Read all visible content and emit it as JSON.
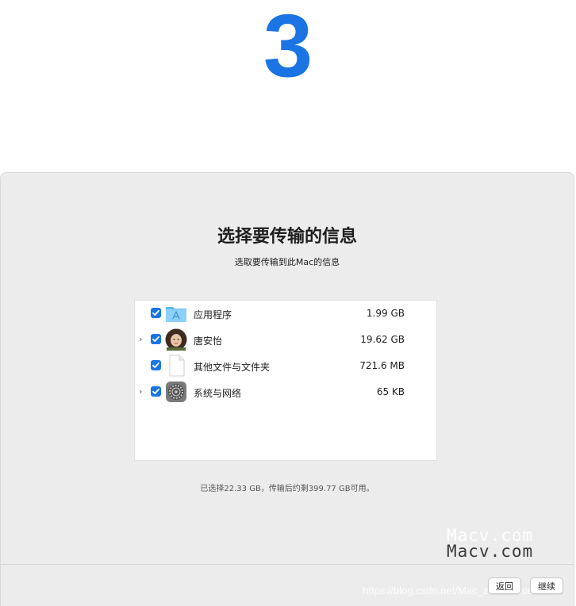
{
  "step_number": "3",
  "dialog": {
    "title": "选择要传输的信息",
    "subtitle": "选取要传输到此Mac的信息",
    "items": [
      {
        "label": "应用程序",
        "size": "1.99 GB",
        "checked": true,
        "expandable": false,
        "icon": "applications-folder-icon"
      },
      {
        "label": "唐安怡",
        "size": "19.62 GB",
        "checked": true,
        "expandable": true,
        "icon": "user-avatar-icon"
      },
      {
        "label": "其他文件与文件夹",
        "size": "721.6 MB",
        "checked": true,
        "expandable": false,
        "icon": "document-icon"
      },
      {
        "label": "系统与网络",
        "size": "65 KB",
        "checked": true,
        "expandable": true,
        "icon": "system-preferences-gear-icon"
      }
    ],
    "status": "已选择22.33 GB，传输后约剩399.77 GB可用。",
    "back_label": "返回",
    "continue_label": "继续"
  },
  "watermarks": {
    "logo_top": "Macv.com",
    "logo_bottom": "Macv.com",
    "url": "https://blog.csdn.net/Mac_zouduosou"
  },
  "colors": {
    "accent": "#1a74e4",
    "panel_bg": "#ececec",
    "list_bg": "#ffffff"
  }
}
